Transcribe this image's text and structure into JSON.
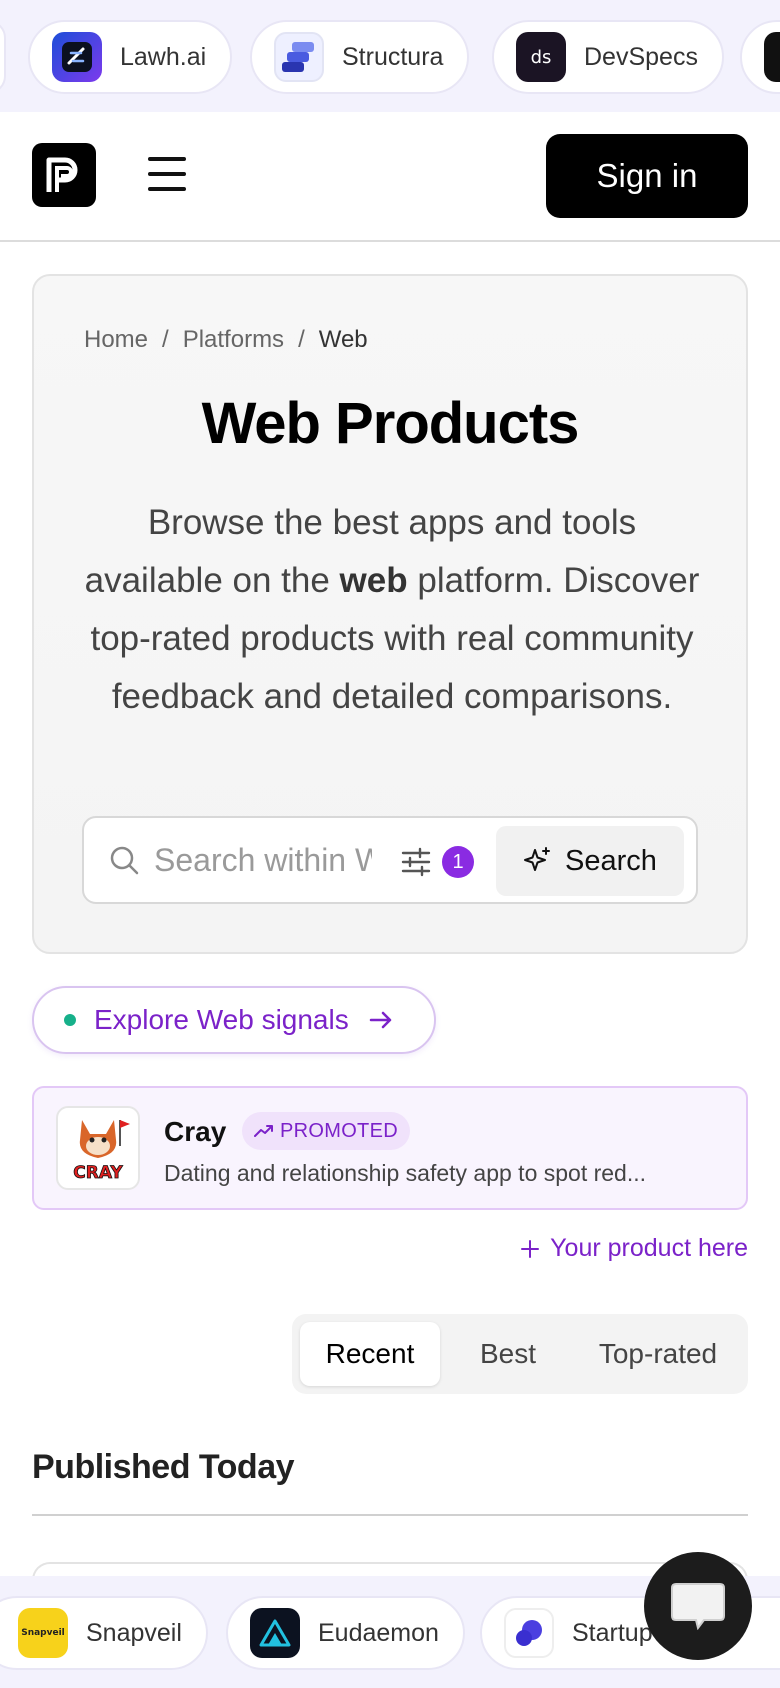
{
  "top_strip": {
    "items": [
      {
        "name": "Lawh.ai",
        "icon": "lawh-logo-icon"
      },
      {
        "name": "Structura",
        "icon": "structura-logo-icon"
      },
      {
        "name": "DevSpecs",
        "icon": "devspecs-logo-icon",
        "logo_text": "ds"
      }
    ]
  },
  "header": {
    "signin_label": "Sign in"
  },
  "hero": {
    "breadcrumb": [
      {
        "label": "Home"
      },
      {
        "label": "/"
      },
      {
        "label": "Platforms"
      },
      {
        "label": "/"
      },
      {
        "label": "Web"
      }
    ],
    "title": "Web Products",
    "desc_part1": "Browse the best apps and tools available on the ",
    "desc_bold": "web",
    "desc_part2": " platform. Discover top-rated products with real community feedback and detailed comparisons.",
    "search_placeholder": "Search within Web",
    "filter_count": "1",
    "search_button": "Search"
  },
  "explore": {
    "label": "Explore Web signals"
  },
  "promoted": {
    "name": "Cray",
    "tag": "PROMOTED",
    "description": "Dating and relationship safety app to spot red...",
    "logo_text": "CRAY"
  },
  "your_product": "Your product here",
  "tabs": [
    {
      "label": "Recent",
      "active": true
    },
    {
      "label": "Best",
      "active": false
    },
    {
      "label": "Top-rated",
      "active": false
    }
  ],
  "section_title": "Published Today",
  "bottom_strip": {
    "items": [
      {
        "name": "Snapveil",
        "icon": "snapveil-logo-icon",
        "logo_text": "Snapveil"
      },
      {
        "name": "Eudaemon",
        "icon": "eudaemon-logo-icon"
      },
      {
        "name": "Startup",
        "icon": "startup-logo-icon"
      }
    ]
  },
  "colors": {
    "accent": "#7b22c9",
    "badge": "#8a2be2",
    "signal_dot": "#16b08a",
    "strip_bg": "#f3f2fd"
  }
}
